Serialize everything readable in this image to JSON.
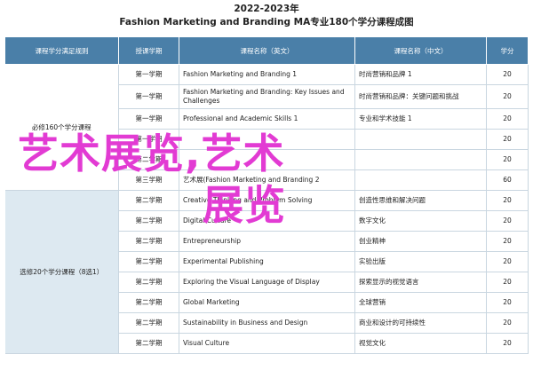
{
  "header": {
    "year": "2022-2023年",
    "title": "Fashion Marketing and Branding MA专业180个学分课程成图"
  },
  "columns": {
    "group": "课程学分满足规则",
    "semester": "授课学期",
    "name_en": "课程名称（英文）",
    "name_cn": "课程名称（中文）",
    "credits": "学分"
  },
  "groups": {
    "core": "必修160个学分课程",
    "elective": "选修20个学分课程（8选1）"
  },
  "core_rows": [
    {
      "semester": "第一学期",
      "en": "Fashion Marketing and Branding 1",
      "cn": "时尚营销和品牌 1",
      "credits": "20"
    },
    {
      "semester": "第一学期",
      "en": "Fashion Marketing and Branding: Key Issues and Challenges",
      "cn": "时尚营销和品牌：关键问题和挑战",
      "credits": "20"
    },
    {
      "semester": "第一学期",
      "en": "Professional and Academic Skills 1",
      "cn": "专业和学术技能 1",
      "credits": "20"
    },
    {
      "semester": "第一学期",
      "en": "",
      "cn": "",
      "credits": "20"
    },
    {
      "semester": "第二学期",
      "en": "",
      "cn": "",
      "credits": "20"
    },
    {
      "semester": "第三学期",
      "en": "Fashion Marketing and Branding 2",
      "cn": "",
      "credits": "60"
    }
  ],
  "core_row6_en": "艺术展(Fashion Marketing and Branding 2",
  "elective_rows": [
    {
      "semester": "第二学期",
      "en": "Creative Thinking and Problem Solving",
      "cn": "创造性思维和解决问题",
      "credits": "20"
    },
    {
      "semester": "第二学期",
      "en": "Digital Culture",
      "cn": "数字文化",
      "credits": "20"
    },
    {
      "semester": "第二学期",
      "en": "Entrepreneurship",
      "cn": "创业精神",
      "credits": "20"
    },
    {
      "semester": "第二学期",
      "en": "Experimental Publishing",
      "cn": "实验出版",
      "credits": "20"
    },
    {
      "semester": "第二学期",
      "en": "Exploring the Visual Language of Display",
      "cn": "探索显示的视觉语言",
      "credits": "20"
    },
    {
      "semester": "第二学期",
      "en": "Global Marketing",
      "cn": "全球营销",
      "credits": "20"
    },
    {
      "semester": "第二学期",
      "en": "Sustainability in Business and Design",
      "cn": "商业和设计的可持续性",
      "credits": "20"
    },
    {
      "semester": "第二学期",
      "en": "Visual Culture",
      "cn": "视觉文化",
      "credits": "20"
    }
  ],
  "overlay": {
    "line1": "艺术展览,艺术",
    "line2": "展览"
  }
}
